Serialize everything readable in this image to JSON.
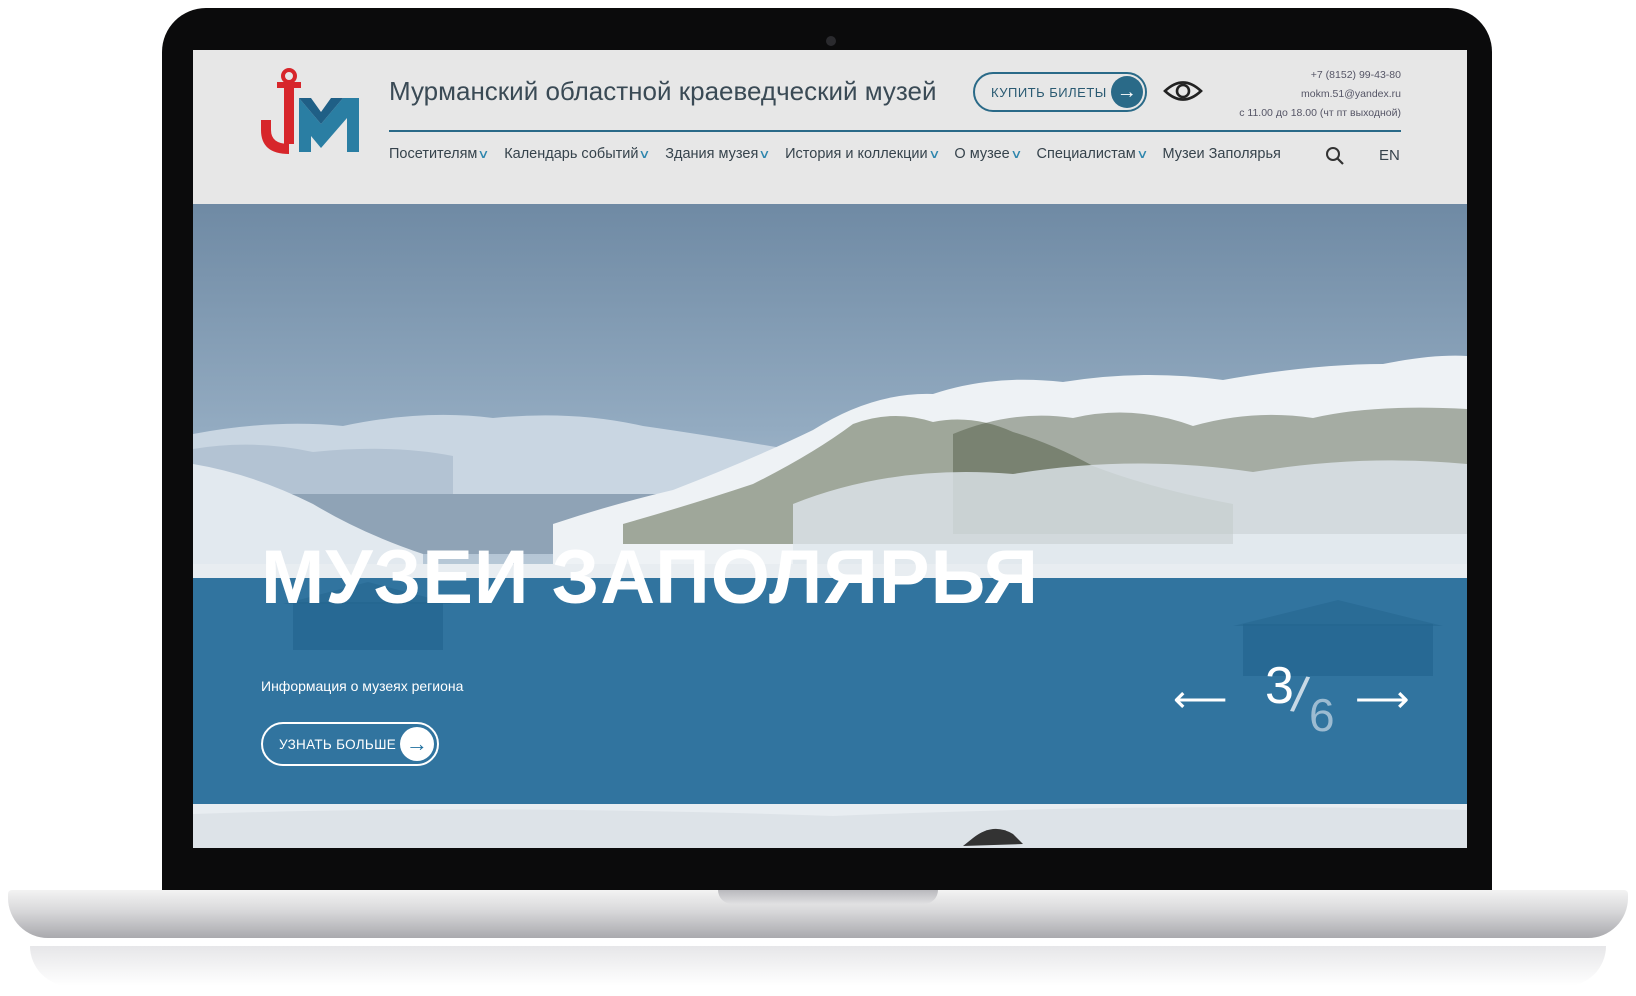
{
  "header": {
    "site_title": "Мурманский областной краеведческий музей",
    "tickets_label": "КУПИТЬ БИЛЕТЫ",
    "contacts": {
      "phone": "+7 (8152) 99-43-80",
      "email": "mokm.51@yandex.ru",
      "hours": "с 11.00 до 18.00 (чт пт выходной)"
    },
    "nav": [
      {
        "label": "Посетителям",
        "dropdown": true
      },
      {
        "label": "Календарь событий",
        "dropdown": true
      },
      {
        "label": "Здания музея",
        "dropdown": true
      },
      {
        "label": "История и коллекции",
        "dropdown": true
      },
      {
        "label": "О музее",
        "dropdown": true
      },
      {
        "label": "Специалистам",
        "dropdown": true
      },
      {
        "label": "Музеи Заполярья",
        "dropdown": false
      }
    ],
    "lang": "EN"
  },
  "hero": {
    "title": "МУЗЕИ ЗАПОЛЯРЬЯ",
    "subtitle": "Информация о музеях региона",
    "button_label": "УЗНАТЬ БОЛЬШЕ",
    "slide_current": "3",
    "slide_total": "6"
  },
  "icons": {
    "logo": "museum-anchor-logo",
    "tickets_arrow": "arrow-right-circle-icon",
    "accessibility": "eye-icon",
    "search": "search-icon",
    "prev": "arrow-left-icon",
    "next": "arrow-right-icon"
  },
  "colors": {
    "accent": "#2a6a88",
    "logo_red": "#d7262b",
    "logo_blue": "#2a7ea3",
    "overlay_blue": "#136092"
  }
}
